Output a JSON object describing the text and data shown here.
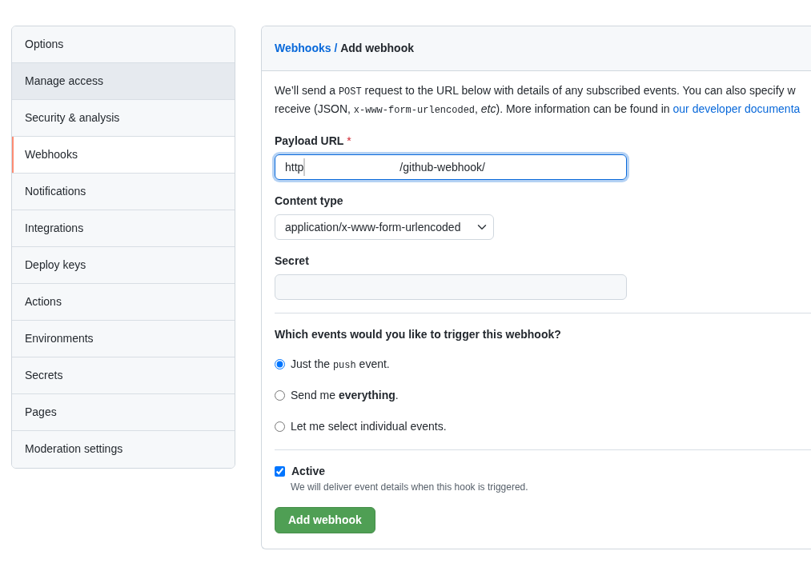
{
  "sidebar": {
    "items": [
      {
        "label": "Options",
        "selected": false,
        "hovered": false
      },
      {
        "label": "Manage access",
        "selected": false,
        "hovered": true
      },
      {
        "label": "Security & analysis",
        "selected": false,
        "hovered": false
      },
      {
        "label": "Webhooks",
        "selected": true,
        "hovered": false
      },
      {
        "label": "Notifications",
        "selected": false,
        "hovered": false
      },
      {
        "label": "Integrations",
        "selected": false,
        "hovered": false
      },
      {
        "label": "Deploy keys",
        "selected": false,
        "hovered": false
      },
      {
        "label": "Actions",
        "selected": false,
        "hovered": false
      },
      {
        "label": "Environments",
        "selected": false,
        "hovered": false
      },
      {
        "label": "Secrets",
        "selected": false,
        "hovered": false
      },
      {
        "label": "Pages",
        "selected": false,
        "hovered": false
      },
      {
        "label": "Moderation settings",
        "selected": false,
        "hovered": false
      }
    ]
  },
  "breadcrumb": {
    "parent": "Webhooks",
    "separator": "/",
    "current": "Add webhook"
  },
  "intro": {
    "lines": [
      [
        {
          "kind": "text",
          "text": "We’ll send a "
        },
        {
          "kind": "code",
          "text": "POST"
        },
        {
          "kind": "text",
          "text": " request to the URL below with details of any subscribed events. You can also specify w"
        }
      ],
      [
        {
          "kind": "text",
          "text": "receive (JSON, "
        },
        {
          "kind": "code",
          "text": "x-www-form-urlencoded"
        },
        {
          "kind": "text",
          "text": ", "
        },
        {
          "kind": "em",
          "text": "etc"
        },
        {
          "kind": "text",
          "text": "). More information can be found in "
        },
        {
          "kind": "link",
          "text": "our developer documenta"
        }
      ]
    ]
  },
  "payload_url": {
    "label": "Payload URL",
    "required_mark": "*",
    "value_start": "http",
    "value_end": "/github-webhook/",
    "redacted": true
  },
  "content_type": {
    "label": "Content type",
    "value": "application/x-www-form-urlencoded"
  },
  "secret": {
    "label": "Secret"
  },
  "events": {
    "question": "Which events would you like to trigger this webhook?",
    "options": [
      {
        "selected": true,
        "parts": [
          {
            "kind": "text",
            "text": "Just the "
          },
          {
            "kind": "code",
            "text": "push"
          },
          {
            "kind": "text",
            "text": " event."
          }
        ]
      },
      {
        "selected": false,
        "parts": [
          {
            "kind": "text",
            "text": "Send me "
          },
          {
            "kind": "bold",
            "text": "everything"
          },
          {
            "kind": "text",
            "text": "."
          }
        ]
      },
      {
        "selected": false,
        "parts": [
          {
            "kind": "text",
            "text": "Let me select individual events."
          }
        ]
      }
    ]
  },
  "active": {
    "label": "Active",
    "checked": true,
    "note": "We will deliver event details when this hook is triggered."
  },
  "submit": {
    "label": "Add webhook"
  }
}
